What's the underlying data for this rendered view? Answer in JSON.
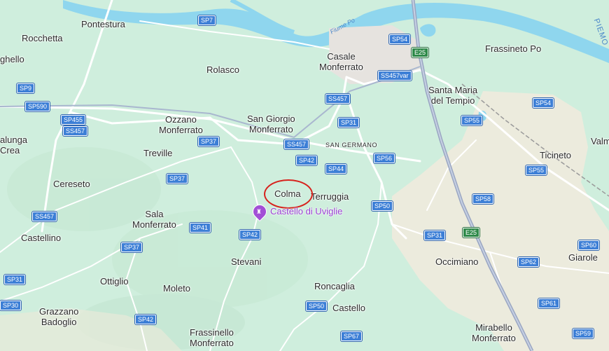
{
  "map": {
    "places": [
      {
        "id": "pontestura",
        "label": "Pontestura"
      },
      {
        "id": "rocchetta",
        "label": "Rocchetta"
      },
      {
        "id": "aghello",
        "label": "ghello"
      },
      {
        "id": "rolasco",
        "label": "Rolasco"
      },
      {
        "id": "casale",
        "label": "Casale\nMonferrato"
      },
      {
        "id": "frassineto",
        "label": "Frassineto Po"
      },
      {
        "id": "santa-maria",
        "label": "Santa Maria\ndel Tempio"
      },
      {
        "id": "ozzano",
        "label": "Ozzano\nMonferrato"
      },
      {
        "id": "san-giorgio",
        "label": "San Giorgio\nMonferrato"
      },
      {
        "id": "san-germano",
        "label": "SAN GERMANO"
      },
      {
        "id": "valunga",
        "label": "alunga\nCrea"
      },
      {
        "id": "treville",
        "label": "Treville"
      },
      {
        "id": "ticineto",
        "label": "Ticineto"
      },
      {
        "id": "valmacca",
        "label": "Valm"
      },
      {
        "id": "cereseto",
        "label": "Cereseto"
      },
      {
        "id": "colma",
        "label": "Colma"
      },
      {
        "id": "terruggia",
        "label": "Terruggia"
      },
      {
        "id": "sala",
        "label": "Sala\nMonferrato"
      },
      {
        "id": "castellino",
        "label": "Castellino"
      },
      {
        "id": "stevani",
        "label": "Stevani"
      },
      {
        "id": "occimiano",
        "label": "Occimiano"
      },
      {
        "id": "giarole",
        "label": "Giarole"
      },
      {
        "id": "ottiglio",
        "label": "Ottiglio"
      },
      {
        "id": "moleto",
        "label": "Moleto"
      },
      {
        "id": "roncaglia",
        "label": "Roncaglia"
      },
      {
        "id": "grazzano",
        "label": "Grazzano\nBadoglio"
      },
      {
        "id": "castello",
        "label": "Castello"
      },
      {
        "id": "frassinello",
        "label": "Frassinello\nMonferrato"
      },
      {
        "id": "mirabello",
        "label": "Mirabello\nMonferrato"
      }
    ],
    "poi": {
      "label": "Castello di Uviglie",
      "icon": "castle-icon",
      "color": "#a24fd6"
    },
    "river_label": "Fiume Po",
    "edge_label": "PIEMO",
    "highlight": {
      "target": "Colma",
      "color": "#d7221d"
    },
    "roads": [
      {
        "id": "sp7",
        "label": "SP7"
      },
      {
        "id": "sp54a",
        "label": "SP54"
      },
      {
        "id": "e25a",
        "label": "E25"
      },
      {
        "id": "ss457var",
        "label": "SS457var"
      },
      {
        "id": "sp9",
        "label": "SP9"
      },
      {
        "id": "sp590",
        "label": "SP590"
      },
      {
        "id": "ss457a",
        "label": "SS457"
      },
      {
        "id": "sp455",
        "label": "SP455"
      },
      {
        "id": "ss457b",
        "label": "SS457"
      },
      {
        "id": "sp54b",
        "label": "SP54"
      },
      {
        "id": "sp31a",
        "label": "SP31"
      },
      {
        "id": "sp55a",
        "label": "SP55"
      },
      {
        "id": "sp37a",
        "label": "SP37"
      },
      {
        "id": "ss457c",
        "label": "SS457"
      },
      {
        "id": "sp56",
        "label": "SP56"
      },
      {
        "id": "sp42a",
        "label": "SP42"
      },
      {
        "id": "sp44",
        "label": "SP44"
      },
      {
        "id": "sp55b",
        "label": "SP55"
      },
      {
        "id": "sp37b",
        "label": "SP37"
      },
      {
        "id": "sp50a",
        "label": "SP50"
      },
      {
        "id": "sp58",
        "label": "SP58"
      },
      {
        "id": "ss457d",
        "label": "SS457"
      },
      {
        "id": "sp41",
        "label": "SP41"
      },
      {
        "id": "sp42b",
        "label": "SP42"
      },
      {
        "id": "sp31b",
        "label": "SP31"
      },
      {
        "id": "e25b",
        "label": "E25"
      },
      {
        "id": "sp37c",
        "label": "SP37"
      },
      {
        "id": "sp60",
        "label": "SP60"
      },
      {
        "id": "sp62",
        "label": "SP62"
      },
      {
        "id": "sp31c",
        "label": "SP31"
      },
      {
        "id": "sp30",
        "label": "SP30"
      },
      {
        "id": "sp50b",
        "label": "SP50"
      },
      {
        "id": "sp61",
        "label": "SP61"
      },
      {
        "id": "sp42c",
        "label": "SP42"
      },
      {
        "id": "sp67",
        "label": "SP67"
      },
      {
        "id": "sp59",
        "label": "SP59"
      }
    ]
  }
}
